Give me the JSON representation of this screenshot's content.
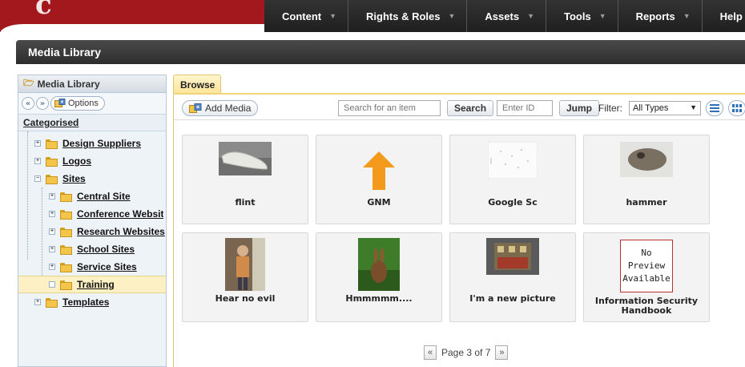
{
  "nav": {
    "items": [
      {
        "label": "Content"
      },
      {
        "label": "Rights & Roles"
      },
      {
        "label": "Assets"
      },
      {
        "label": "Tools"
      },
      {
        "label": "Reports"
      },
      {
        "label": "Help"
      }
    ],
    "logo_glyph": "c"
  },
  "page": {
    "title": "Media Library"
  },
  "left_panel": {
    "header": "Media Library",
    "options_label": "Options",
    "category_label": "Categorised",
    "tree": [
      {
        "label": "Design Suppliers",
        "level": 1
      },
      {
        "label": "Logos",
        "level": 1
      },
      {
        "label": "Sites",
        "level": 1,
        "expanded": true
      },
      {
        "label": "Central Site",
        "level": 2
      },
      {
        "label": "Conference Websit",
        "level": 2
      },
      {
        "label": "Research Websites",
        "level": 2
      },
      {
        "label": "School Sites",
        "level": 2
      },
      {
        "label": "Service Sites",
        "level": 2
      },
      {
        "label": "Training",
        "level": 2,
        "selected": true
      },
      {
        "label": "Templates",
        "level": 1
      }
    ]
  },
  "browse": {
    "tab_label": "Browse",
    "add_media_label": "Add Media",
    "search_placeholder": "Search for an item",
    "search_button": "Search",
    "id_placeholder": "Enter ID",
    "jump_button": "Jump",
    "filter_label": "Filter:",
    "filter_value": "All Types"
  },
  "items": [
    {
      "caption": "flint"
    },
    {
      "caption": "GNM"
    },
    {
      "caption": "Google Sc"
    },
    {
      "caption": "hammer"
    },
    {
      "caption": "Hear no evil"
    },
    {
      "caption": "Hmmmmm...."
    },
    {
      "caption": "I'm a new picture"
    },
    {
      "caption": "Information Security Handbook",
      "no_preview_text": "No Preview Available"
    }
  ],
  "pager": {
    "text": "Page 3 of 7"
  },
  "colors": {
    "brand_red": "#b51f23",
    "nav_dark": "#2a2a2a",
    "accent_yellow": "#fde497",
    "panel_blue": "#eef3f8"
  }
}
